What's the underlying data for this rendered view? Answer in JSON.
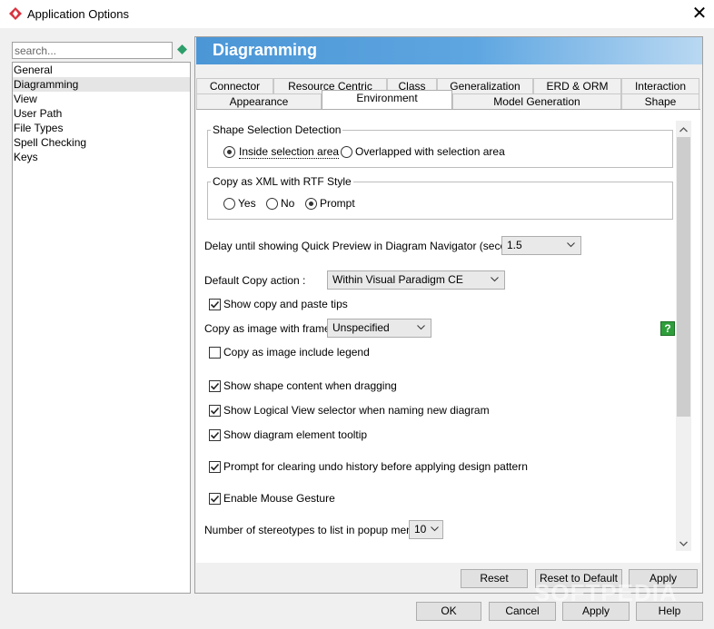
{
  "window": {
    "title": "Application Options",
    "close_glyph": "✕"
  },
  "search": {
    "placeholder": "search..."
  },
  "sidebar": {
    "items": [
      {
        "label": "General"
      },
      {
        "label": "Diagramming"
      },
      {
        "label": "View"
      },
      {
        "label": "User Path"
      },
      {
        "label": "File Types"
      },
      {
        "label": "Spell Checking"
      },
      {
        "label": "Keys"
      }
    ],
    "selected": "Diagramming"
  },
  "header": {
    "title": "Diagramming"
  },
  "tabs": {
    "row1": [
      "Connector",
      "Resource Centric",
      "Class",
      "Generalization",
      "ERD & ORM",
      "Interaction"
    ],
    "row2": [
      "Appearance",
      "Environment",
      "Model Generation",
      "Shape"
    ],
    "active": "Environment"
  },
  "environment": {
    "shape_selection": {
      "title": "Shape Selection Detection",
      "options": [
        "Inside selection area",
        "Overlapped with selection area"
      ],
      "selected": "Inside selection area"
    },
    "copy_xml": {
      "title": "Copy as XML with RTF Style",
      "options": [
        "Yes",
        "No",
        "Prompt"
      ],
      "selected": "Prompt"
    },
    "quick_preview": {
      "label": "Delay until showing Quick Preview in Diagram Navigator (seconds) :",
      "value": "1.5"
    },
    "default_copy": {
      "label": "Default Copy action :",
      "value": "Within Visual Paradigm CE"
    },
    "show_copy_tips": {
      "label": "Show copy and paste tips",
      "checked": true
    },
    "copy_frame": {
      "label": "Copy as image with frame :",
      "value": "Unspecified"
    },
    "copy_legend": {
      "label": "Copy as image include legend",
      "checked": false
    },
    "show_shape_content": {
      "label": "Show shape content when dragging",
      "checked": true
    },
    "show_logical_view": {
      "label": "Show Logical View selector when naming new diagram",
      "checked": true
    },
    "show_tooltip": {
      "label": "Show diagram element tooltip",
      "checked": true
    },
    "prompt_undo": {
      "label": "Prompt for clearing undo history before applying design pattern",
      "checked": true
    },
    "mouse_gesture": {
      "label": "Enable Mouse Gesture",
      "checked": true
    },
    "stereotypes": {
      "label": "Number of stereotypes to list in popup menu :",
      "value": "10"
    },
    "help_glyph": "?"
  },
  "panel_buttons": {
    "reset": "Reset",
    "reset_default": "Reset to Default",
    "apply": "Apply"
  },
  "dialog_buttons": {
    "ok": "OK",
    "cancel": "Cancel",
    "apply": "Apply",
    "help": "Help"
  },
  "watermark": "SOFTPEDIA",
  "colors": {
    "header_start": "#4b96d6",
    "header_end": "#b9d8f2",
    "help_green": "#2e9e3a",
    "app_icon_red": "#d9333f"
  }
}
